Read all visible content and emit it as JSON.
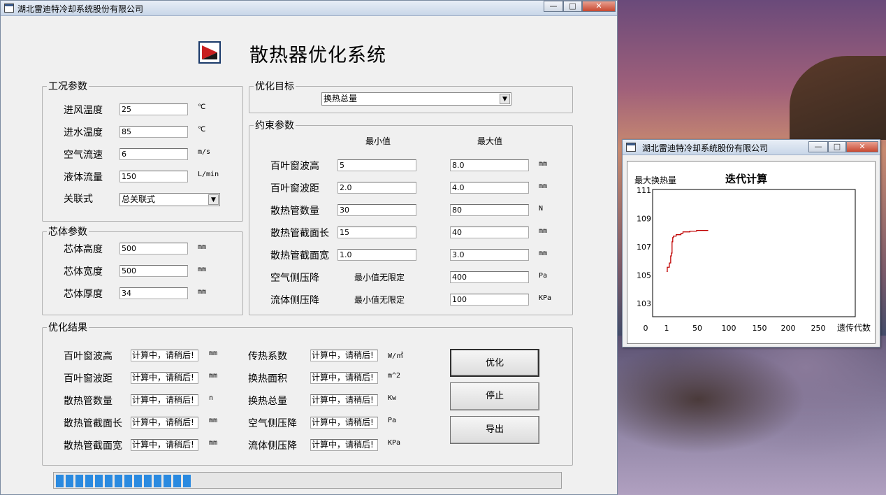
{
  "main_window": {
    "title": "湖北雷迪特冷却系统股份有限公司",
    "minimize": "—",
    "maximize": "□",
    "close": "✕"
  },
  "app_title": "散热器优化系统",
  "condition_group": {
    "legend": "工况参数",
    "rows": [
      {
        "label": "进风温度",
        "value": "25",
        "unit": "℃"
      },
      {
        "label": "进水温度",
        "value": "85",
        "unit": "℃"
      },
      {
        "label": "空气流速",
        "value": "6",
        "unit": "m/s"
      },
      {
        "label": "液体流量",
        "value": "150",
        "unit": "L/min"
      }
    ],
    "assoc_label": "关联式",
    "assoc_value": "总关联式"
  },
  "core_group": {
    "legend": "芯体参数",
    "rows": [
      {
        "label": "芯体高度",
        "value": "500",
        "unit": "mm"
      },
      {
        "label": "芯体宽度",
        "value": "500",
        "unit": "mm"
      },
      {
        "label": "芯体厚度",
        "value": "34",
        "unit": "mm"
      }
    ]
  },
  "objective_group": {
    "legend": "优化目标",
    "value": "换热总量"
  },
  "constraint_group": {
    "legend": "约束参数",
    "min_header": "最小值",
    "max_header": "最大值",
    "rows": [
      {
        "label": "百叶窗波高",
        "min": "5",
        "max": "8.0",
        "unit": "mm"
      },
      {
        "label": "百叶窗波距",
        "min": "2.0",
        "max": "4.0",
        "unit": "mm"
      },
      {
        "label": "散热管数量",
        "min": "30",
        "max": "80",
        "unit": "N"
      },
      {
        "label": "散热管截面长",
        "min": "15",
        "max": "40",
        "unit": "mm"
      },
      {
        "label": "散热管截面宽",
        "min": "1.0",
        "max": "3.0",
        "unit": "mm"
      },
      {
        "label": "空气侧压降",
        "min_text": "最小值无限定",
        "max": "400",
        "unit": "Pa"
      },
      {
        "label": "流体侧压降",
        "min_text": "最小值无限定",
        "max": "100",
        "unit": "KPa"
      }
    ]
  },
  "result_group": {
    "legend": "优化结果",
    "left": [
      {
        "label": "百叶窗波高",
        "value": "计算中，请稍后!",
        "unit": "mm"
      },
      {
        "label": "百叶窗波距",
        "value": "计算中，请稍后!",
        "unit": "mm"
      },
      {
        "label": "散热管数量",
        "value": "计算中，请稍后!",
        "unit": "n"
      },
      {
        "label": "散热管截面长",
        "value": "计算中，请稍后!",
        "unit": "mm"
      },
      {
        "label": "散热管截面宽",
        "value": "计算中，请稍后!",
        "unit": "mm"
      }
    ],
    "right": [
      {
        "label": "传热系数",
        "value": "计算中，请稍后!",
        "unit": "W/㎡"
      },
      {
        "label": "换热面积",
        "value": "计算中，请稍后!",
        "unit": "m^2"
      },
      {
        "label": "换热总量",
        "value": "计算中，请稍后!",
        "unit": "Kw"
      },
      {
        "label": "空气侧压降",
        "value": "计算中，请稍后!",
        "unit": "Pa"
      },
      {
        "label": "流体侧压降",
        "value": "计算中，请稍后!",
        "unit": "KPa"
      }
    ]
  },
  "buttons": {
    "optimize": "优化",
    "stop": "停止",
    "export": "导出"
  },
  "progress": {
    "filled_segments": 14,
    "fraction": 0.26
  },
  "chart_window": {
    "title": "湖北雷迪特冷却系统股份有限公司",
    "minimize": "—",
    "maximize": "□",
    "close": "✕"
  },
  "chart_data": {
    "type": "line",
    "title": "迭代计算",
    "ylabel": "最大换热量",
    "xlabel": "遗传代数",
    "y_ticks": [
      "111",
      "109",
      "107",
      "105",
      "103"
    ],
    "x_ticks": [
      "0",
      "1",
      "50",
      "100",
      "150",
      "200",
      "250"
    ],
    "xlim": [
      0,
      300
    ],
    "ylim": [
      102,
      111
    ],
    "line_color": "#c00000",
    "series": [
      {
        "x": [
          1,
          2,
          3,
          4,
          5,
          6,
          7,
          8,
          9,
          10,
          11,
          12,
          13,
          14,
          15,
          16,
          18,
          20,
          22,
          25,
          28,
          30,
          35,
          40,
          45,
          50,
          55,
          60,
          62
        ],
        "y": [
          105.2,
          105.5,
          105.5,
          105.5,
          105.8,
          105.8,
          106.3,
          106.5,
          107.3,
          107.6,
          107.7,
          107.7,
          107.7,
          107.7,
          107.8,
          107.8,
          107.8,
          107.8,
          107.9,
          108.0,
          108.0,
          108.0,
          108.05,
          108.05,
          108.1,
          108.1,
          108.1,
          108.1,
          108.1
        ]
      }
    ]
  }
}
